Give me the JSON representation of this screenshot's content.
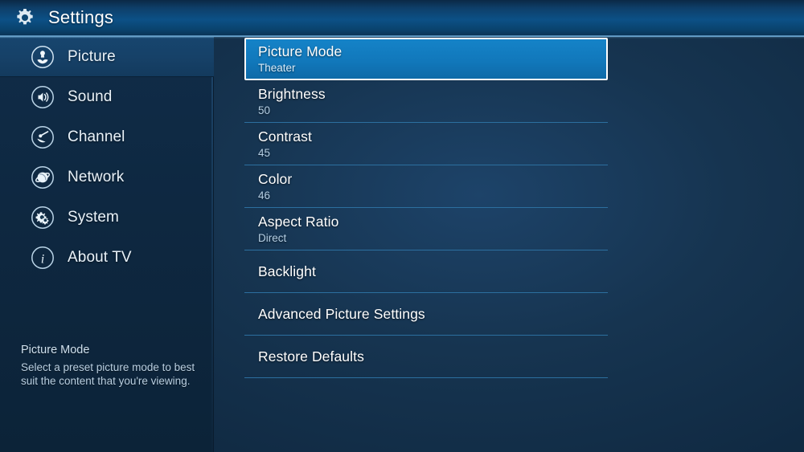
{
  "header": {
    "title": "Settings",
    "icon": "gear-icon"
  },
  "sidebar": {
    "items": [
      {
        "label": "Picture",
        "icon": "flower-icon",
        "active": true
      },
      {
        "label": "Sound",
        "icon": "speaker-icon",
        "active": false
      },
      {
        "label": "Channel",
        "icon": "satellite-dish-icon",
        "active": false
      },
      {
        "label": "Network",
        "icon": "globe-icon",
        "active": false
      },
      {
        "label": "System",
        "icon": "gears-icon",
        "active": false
      },
      {
        "label": "About TV",
        "icon": "info-icon",
        "active": false
      }
    ],
    "help": {
      "title": "Picture Mode",
      "body": "Select a preset picture mode to best suit the content that you're viewing."
    }
  },
  "settings_list": {
    "rows": [
      {
        "label": "Picture Mode",
        "value": "Theater",
        "selected": true
      },
      {
        "label": "Brightness",
        "value": "50",
        "selected": false
      },
      {
        "label": "Contrast",
        "value": "45",
        "selected": false
      },
      {
        "label": "Color",
        "value": "46",
        "selected": false
      },
      {
        "label": "Aspect Ratio",
        "value": "Direct",
        "selected": false
      },
      {
        "label": "Backlight",
        "value": "",
        "selected": false
      },
      {
        "label": "Advanced Picture Settings",
        "value": "",
        "selected": false
      },
      {
        "label": "Restore Defaults",
        "value": "",
        "selected": false
      }
    ]
  },
  "colors": {
    "header_blue": "#0c5086",
    "accent_highlight": "#1179bc",
    "selection_border": "#ffffff",
    "separator": "#2c6f9f",
    "background_dark": "#0d2237",
    "text_primary": "#ffffff",
    "text_secondary": "#b5cfe4"
  }
}
